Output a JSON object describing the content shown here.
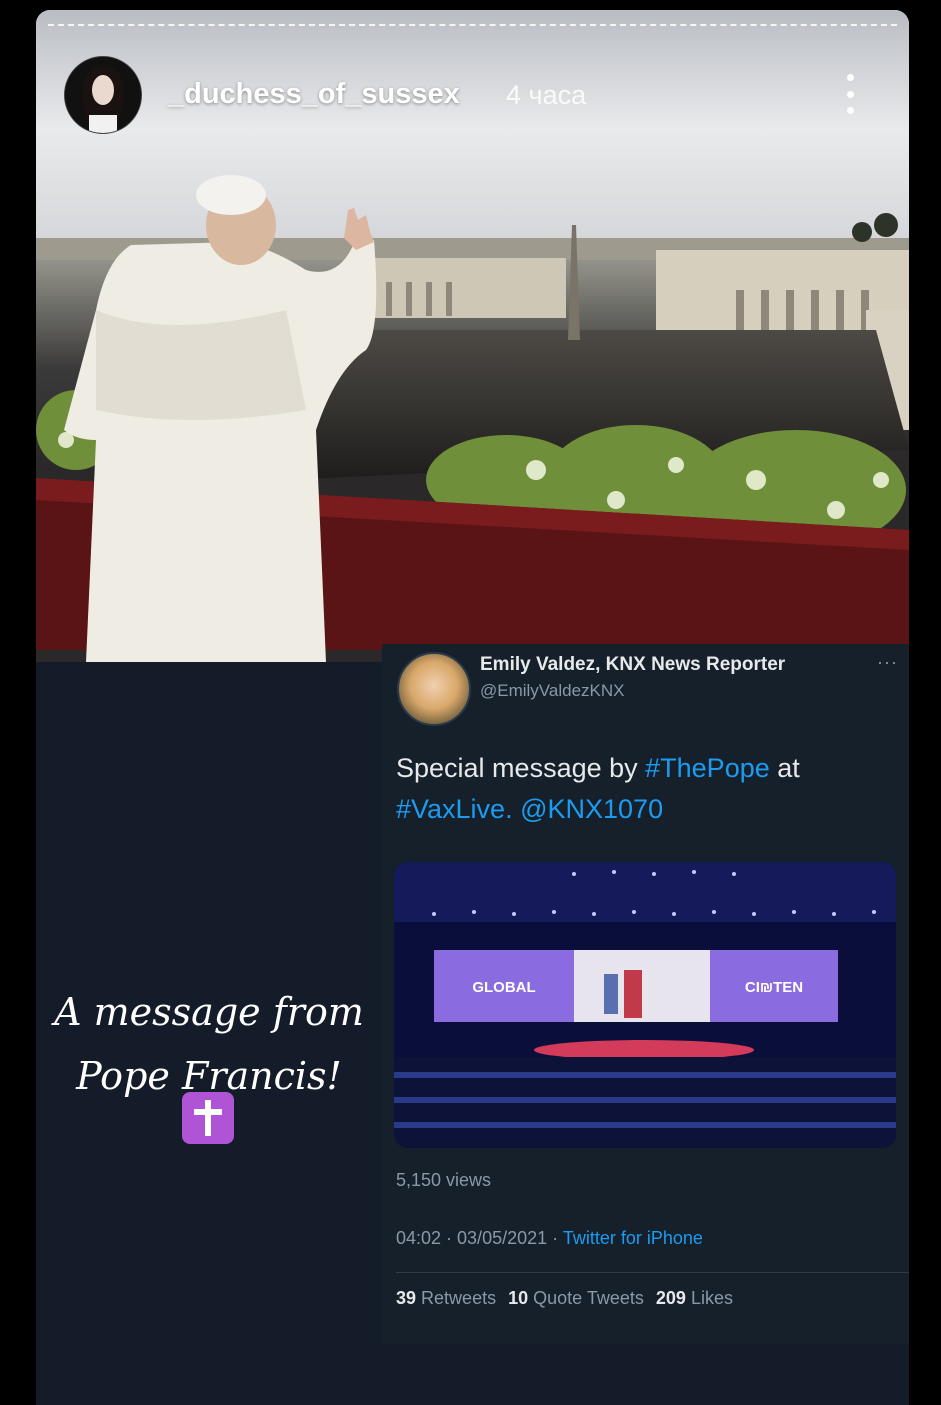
{
  "story": {
    "username": "_duchess_of_sussex",
    "timestamp": "4 часа",
    "caption_line1": "A message from",
    "caption_line2": "Pope Francis!",
    "emoji_icon": "latin-cross-icon"
  },
  "tweet": {
    "author_name": "Emily Valdez, KNX News Reporter",
    "author_handle": "@EmilyValdezKNX",
    "more_glyph": "···",
    "text_prefix": "Special message by ",
    "hashtag_pope": "#ThePope",
    "text_mid": " at",
    "hashtag_vaxlive": "#VaxLive.",
    "mention": "@KNX1070",
    "screen_left": "GLOBAL",
    "screen_right": "CI₪TEN",
    "views": "5,150 views",
    "time": "04:02 · 03/05/2021 · ",
    "source": "Twitter for iPhone",
    "retweets_count": "39",
    "retweets_label": "Retweets",
    "quotes_count": "10",
    "quotes_label": "Quote Tweets",
    "likes_count": "209",
    "likes_label": "Likes"
  }
}
